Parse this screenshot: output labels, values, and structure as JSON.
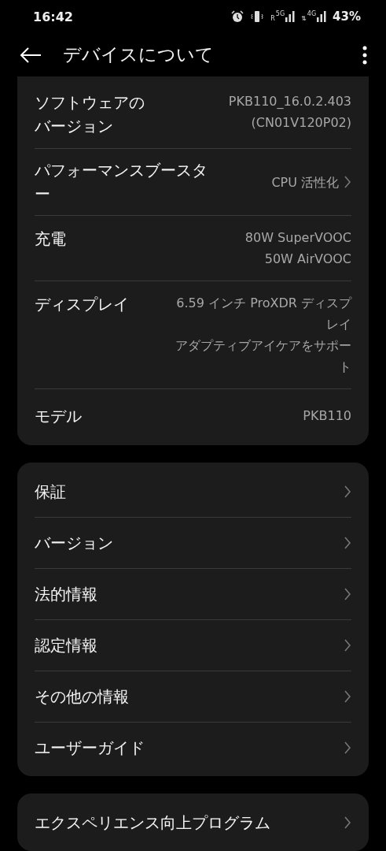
{
  "status_bar": {
    "time": "16:42",
    "networks": [
      {
        "label": "5G",
        "roaming": "R"
      },
      {
        "label": "4G",
        "roaming": "⇅"
      }
    ],
    "battery": "43%"
  },
  "header": {
    "title": "デバイスについて"
  },
  "cards": [
    {
      "rows": [
        {
          "kind": "info",
          "label": "ソフトウェアのバージョン",
          "values": [
            "PKB110_16.0.2.403",
            "(CN01V120P02)"
          ]
        },
        {
          "kind": "link",
          "label": "パフォーマンスブースター",
          "values": [
            "CPU 活性化"
          ]
        },
        {
          "kind": "info",
          "label": "充電",
          "values": [
            "80W SuperVOOC",
            "50W AirVOOC"
          ]
        },
        {
          "kind": "info",
          "label": "ディスプレイ",
          "values": [
            "6.59 インチ ProXDR ディスプレイ",
            "アダプティブアイケアをサポート"
          ]
        },
        {
          "kind": "info",
          "label": "モデル",
          "values": [
            "PKB110"
          ]
        }
      ]
    },
    {
      "rows": [
        {
          "kind": "link",
          "label": "保証"
        },
        {
          "kind": "link",
          "label": "バージョン"
        },
        {
          "kind": "link",
          "label": "法的情報"
        },
        {
          "kind": "link",
          "label": "認定情報"
        },
        {
          "kind": "link",
          "label": "その他の情報"
        },
        {
          "kind": "link",
          "label": "ユーザーガイド"
        }
      ]
    },
    {
      "rows": [
        {
          "kind": "link",
          "label": "エクスペリエンス向上プログラム"
        }
      ]
    }
  ]
}
